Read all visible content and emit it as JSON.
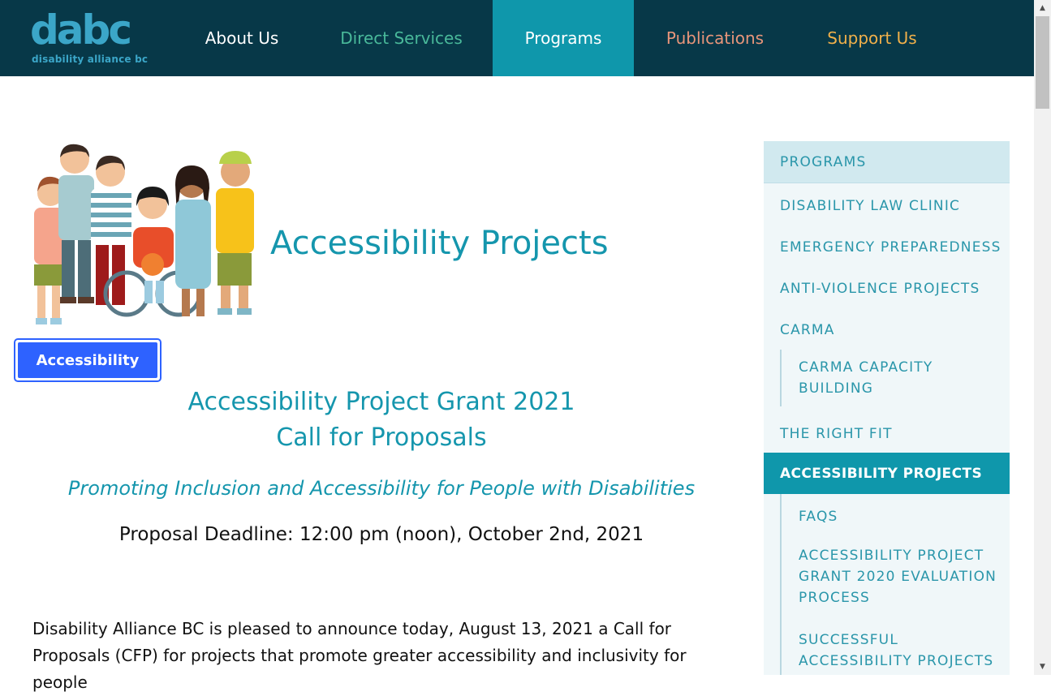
{
  "brand": {
    "logo_word": "dabc",
    "logo_sub": "disability alliance bc"
  },
  "nav": {
    "about": "About Us",
    "direct": "Direct Services",
    "programs": "Programs",
    "publications": "Publications",
    "support": "Support Us"
  },
  "page": {
    "title": "Accessibility Projects",
    "accessibility_button": "Accessibility",
    "grant_title_line1": "Accessibility Project Grant 2021",
    "grant_title_line2": "Call for Proposals",
    "tagline": "Promoting Inclusion and Accessibility for People with Disabilities",
    "deadline": "Proposal Deadline: 12:00 pm (noon), October 2nd, 2021",
    "intro_line1": "Disability Alliance BC is pleased to announce today, August 13, 2021 a Call for",
    "intro_line2": "Proposals (CFP) for projects that promote greater accessibility and inclusivity for people"
  },
  "sidebar": {
    "heading": "PROGRAMS",
    "items": [
      "DISABILITY LAW CLINIC",
      "EMERGENCY PREPAREDNESS",
      "ANTI-VIOLENCE PROJECTS",
      "CARMA",
      "THE RIGHT FIT",
      "ACCESSIBILITY PROJECTS"
    ],
    "carma_sub": [
      "CARMA CAPACITY BUILDING"
    ],
    "accessibility_sub": [
      "FAQS",
      "ACCESSIBILITY PROJECT GRANT 2020 EVALUATION PROCESS",
      "SUCCESSFUL ACCESSIBILITY PROJECTS"
    ]
  },
  "icons": {
    "scroll_up": "arrow-up-icon",
    "scroll_down": "arrow-down-icon"
  },
  "colors": {
    "header_bg": "#073848",
    "accent": "#0f97ab",
    "title_teal": "#1596ad",
    "nav_direct": "#49b99a",
    "nav_publications": "#e8957a",
    "nav_support": "#f0b04a",
    "a11y_button": "#2e62ff"
  }
}
